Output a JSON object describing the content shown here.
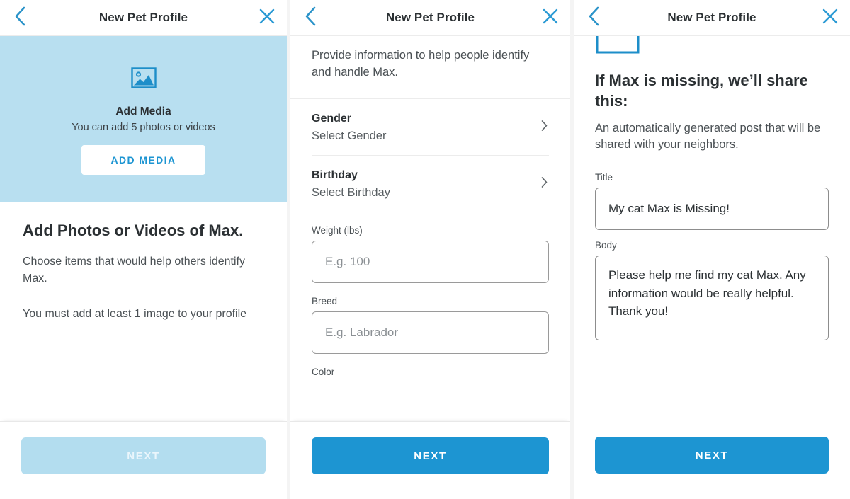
{
  "accent": "#1d95d2",
  "accent_light": "#b3ddef",
  "media_bg": "#b8dff0",
  "header": {
    "title": "New Pet Profile",
    "back_icon": "chevron-left-icon",
    "close_icon": "close-x-icon"
  },
  "screen1": {
    "media": {
      "icon": "image-placeholder-icon",
      "title": "Add Media",
      "subtitle": "You can add 5 photos or videos",
      "button_label": "ADD MEDIA"
    },
    "heading": "Add Photos or Videos of Max.",
    "paragraph1": "Choose items that would help others identify Max.",
    "paragraph2": "You must add at least 1 image to your profile",
    "next_label": "NEXT",
    "next_enabled": false
  },
  "screen2": {
    "intro": "Provide information to help people identify and handle Max.",
    "rows": [
      {
        "label": "Gender",
        "value": "Select Gender",
        "chevron": "chevron-right-icon"
      },
      {
        "label": "Birthday",
        "value": "Select Birthday",
        "chevron": "chevron-right-icon"
      }
    ],
    "fields": [
      {
        "label": "Weight (lbs)",
        "placeholder": "E.g. 100",
        "value": ""
      },
      {
        "label": "Breed",
        "placeholder": "E.g. Labrador",
        "value": ""
      }
    ],
    "clipped_label": "Color",
    "next_label": "NEXT",
    "next_enabled": true
  },
  "screen3": {
    "clipped_icon": "square-outline-icon",
    "heading": "If Max is missing, we’ll share this:",
    "paragraph": "An automatically generated post that will be shared with your neighbors.",
    "title_field": {
      "label": "Title",
      "value": "My cat Max is Missing!",
      "placeholder": "Title"
    },
    "body_field": {
      "label": "Body",
      "value": "Please help me find my cat Max. Any information would be really helpful. Thank you!",
      "placeholder": "Body"
    },
    "next_label": "NEXT",
    "next_enabled": true
  }
}
